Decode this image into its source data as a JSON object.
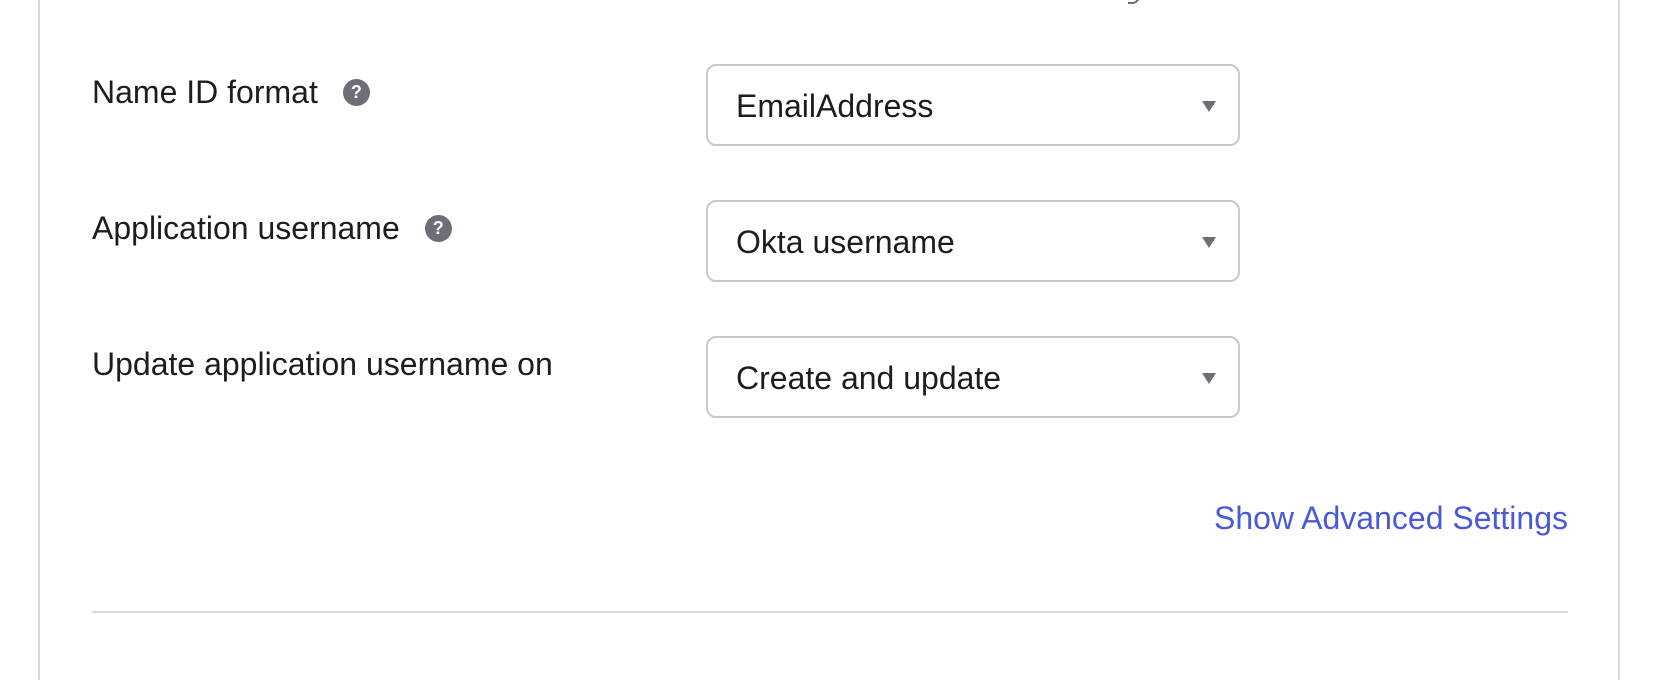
{
  "form": {
    "fields": [
      {
        "label": "Name ID format",
        "has_help": true,
        "help_icon": "question-circle-icon",
        "value": "EmailAddress"
      },
      {
        "label": "Application username",
        "has_help": true,
        "help_icon": "question-circle-icon",
        "value": "Okta username"
      },
      {
        "label": "Update application username on",
        "has_help": false,
        "value": "Create and update"
      }
    ],
    "help_glyph": "?",
    "advanced_link_label": "Show Advanced Settings"
  },
  "colors": {
    "link": "#4a5ad6",
    "text": "#1d1d21",
    "help_icon_bg": "#6e6e78",
    "border": "#c8c8cd"
  }
}
